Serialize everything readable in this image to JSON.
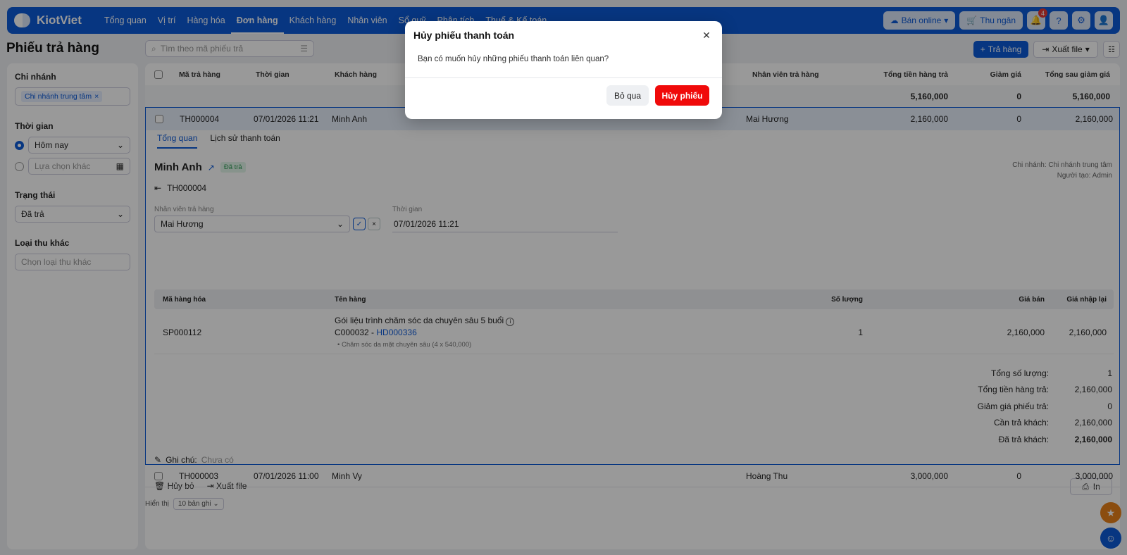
{
  "app": {
    "brand": "KiotViet"
  },
  "nav": {
    "items": [
      "Tổng quan",
      "Vị trí",
      "Hàng hóa",
      "Đơn hàng",
      "Khách hàng",
      "Nhân viên",
      "Sổ quỹ",
      "Phân tích",
      "Thuế & Kế toán"
    ],
    "active_index": 3
  },
  "topright": {
    "online_label": "Bán online",
    "cashier_label": "Thu ngân",
    "notif_count": "4"
  },
  "page": {
    "title": "Phiếu trả hàng",
    "search_placeholder": "Tìm theo mã phiếu trả",
    "return_button": "Trả hàng",
    "export_button": "Xuất file"
  },
  "sidebar": {
    "branch_label": "Chi nhánh",
    "branch_tag": "Chi nhánh trung tâm",
    "time_label": "Thời gian",
    "time_today": "Hôm nay",
    "time_other_placeholder": "Lựa chọn khác",
    "status_label": "Trạng thái",
    "status_value": "Đã trả",
    "other_income_label": "Loại thu khác",
    "other_income_placeholder": "Chọn loại thu khác"
  },
  "table": {
    "headers": {
      "code": "Mã trả hàng",
      "time": "Thời gian",
      "customer": "Khách hàng",
      "staff": "Nhân viên trả hàng",
      "total": "Tổng tiền hàng trả",
      "discount": "Giảm giá",
      "after_discount": "Tổng sau giảm giá"
    },
    "summary": {
      "total": "5,160,000",
      "discount": "0",
      "after_discount": "5,160,000"
    },
    "rows": [
      {
        "code": "TH000004",
        "time": "07/01/2026 11:21",
        "customer": "Minh Anh",
        "staff": "Mai Hương",
        "total": "2,160,000",
        "discount": "0",
        "after_discount": "2,160,000"
      },
      {
        "code": "TH000003",
        "time": "07/01/2026 11:00",
        "customer": "Minh Vy",
        "staff": "Hoàng Thu",
        "total": "3,000,000",
        "discount": "0",
        "after_discount": "3,000,000"
      }
    ]
  },
  "detail": {
    "tab_overview": "Tổng quan",
    "tab_history": "Lịch sử thanh toán",
    "customer": "Minh Anh",
    "status_badge": "Đã trả",
    "branch_info": "Chi nhánh: Chi nhánh trung tâm",
    "creator_info": "Người tạo: Admin",
    "code": "TH000004",
    "staff_label": "Nhân viên trả hàng",
    "staff_value": "Mai Hương",
    "time_label": "Thời gian",
    "time_value": "07/01/2026 11:21",
    "items_headers": {
      "sku": "Mã hàng hóa",
      "name": "Tên hàng",
      "qty": "Số lượng",
      "price": "Giá bán",
      "import_price": "Giá nhập lại"
    },
    "item": {
      "sku": "SP000112",
      "name": "Gói liệu trình chăm sóc da chuyên sâu 5 buổi",
      "customer_code": "C000032 - ",
      "invoice_link": "HD000336",
      "sub_item": "Chăm sóc da mặt chuyên sâu (4 x 540,000)",
      "qty": "1",
      "price": "2,160,000",
      "import_price": "2,160,000"
    },
    "totals": [
      {
        "label": "Tổng số lượng:",
        "value": "1"
      },
      {
        "label": "Tổng tiền hàng trả:",
        "value": "2,160,000"
      },
      {
        "label": "Giảm giá phiếu trả:",
        "value": "0"
      },
      {
        "label": "Cần trả khách:",
        "value": "2,160,000"
      },
      {
        "label": "Đã trả khách:",
        "value": "2,160,000"
      }
    ],
    "note_label": "Ghi chú:",
    "note_value": "Chưa có",
    "cancel_action": "Hủy bỏ",
    "export_action": "Xuất file",
    "print_action": "In"
  },
  "pagination": {
    "show_label": "Hiển thị",
    "rows_option": "10 bản ghi"
  },
  "modal": {
    "title": "Hủy phiếu thanh toán",
    "message": "Bạn có muốn hủy những phiếu thanh toán liên quan?",
    "skip_button": "Bỏ qua",
    "confirm_button": "Hủy phiếu"
  },
  "colors": {
    "primary": "#0d5ad8",
    "danger": "#f00a0a",
    "fab_star": "#e8801a"
  }
}
